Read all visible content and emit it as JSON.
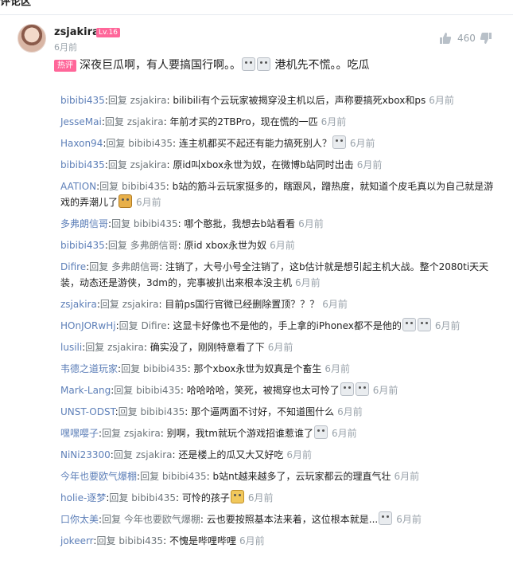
{
  "header_cut_text": "评论区",
  "main_comment": {
    "username": "zsjakira",
    "level": "Lv.16",
    "time": "6月前",
    "likes": "460",
    "badge": "热评",
    "text_before": "深夜巨瓜啊，有人要搞国行啊。。",
    "text_after": "港机先不慌。。吃瓜"
  },
  "replies": [
    {
      "user": "bibibi435",
      "reply_to": "zsjakira",
      "text": "bilibili有个云玩家被揭穿没主机以后，声称要搞死xbox和ps",
      "time": "6月前",
      "emotes": []
    },
    {
      "user": "JesseMai",
      "reply_to": "zsjakira",
      "text": "年前才买的2TBPro，现在慌的一匹",
      "time": "6月前",
      "emotes": []
    },
    {
      "user": "Haxon94",
      "reply_to": "bibibi435",
      "text": "连主机都买不起还有能力搞死别人？",
      "time": "6月前",
      "emotes": [
        "face"
      ]
    },
    {
      "user": "bibibi435",
      "reply_to": "zsjakira",
      "text": "原id叫xbox永世为奴，在微博b站同时出击",
      "time": "6月前",
      "emotes": []
    },
    {
      "user": "AATION",
      "reply_to": "bibibi435",
      "text": "b站的筋斗云玩家挺多的，瞎跟风，蹭热度，就知道个皮毛真以为自己就是游戏的弄潮儿了",
      "time": "6月前",
      "emotes": [
        "dog"
      ]
    },
    {
      "user": "多弗朗信哥",
      "reply_to": "bibibi435",
      "text": "哪个憨批，我想去b站看看",
      "time": "6月前",
      "emotes": []
    },
    {
      "user": "bibibi435",
      "reply_to": "多弗朗信哥",
      "text": "原id xbox永世为奴",
      "time": "6月前",
      "emotes": []
    },
    {
      "user": "Difire",
      "reply_to": "多弗朗信哥",
      "text": "注销了，大号小号全注销了，这b估计就是想引起主机大战。整个2080ti天天装，动态还是游侠，3dm的，完事被扒出来根本没主机",
      "time": "6月前",
      "emotes": []
    },
    {
      "user": "zsjakira",
      "reply_to": "zsjakira",
      "text": "目前ps国行官微已经删除置顶？？？",
      "time": "6月前",
      "emotes": []
    },
    {
      "user": "HOnJORwHj",
      "reply_to": "Difire",
      "text": "这显卡好像也不是他的，手上拿的iPhonex都不是他的",
      "time": "6月前",
      "emotes": [
        "face",
        "face"
      ]
    },
    {
      "user": "lusili",
      "reply_to": "zsjakira",
      "text": "确实没了，刚刚特意看了下",
      "time": "6月前",
      "emotes": []
    },
    {
      "user": "韦德之道玩家",
      "reply_to": "bibibi435",
      "text": "那个xbox永世为奴真是个畜生",
      "time": "6月前",
      "emotes": []
    },
    {
      "user": "Mark-Lang",
      "reply_to": "bibibi435",
      "text": "哈哈哈哈，笑死，被揭穿也太可怜了",
      "time": "6月前",
      "emotes": [
        "face",
        "face"
      ]
    },
    {
      "user": "UNST-ODST",
      "reply_to": "bibibi435",
      "text": "那个逼两面不讨好，不知道图什么",
      "time": "6月前",
      "emotes": []
    },
    {
      "user": "嘿嘿嘤子",
      "reply_to": "zsjakira",
      "text": "别啊，我tm就玩个游戏招谁惹谁了",
      "time": "6月前",
      "emotes": [
        "face"
      ]
    },
    {
      "user": "NiNi23300",
      "reply_to": "zsjakira",
      "text": "还是楼上的瓜又大又好吃",
      "time": "6月前",
      "emotes": []
    },
    {
      "user": "今年也要欧气爆棚",
      "reply_to": "bibibi435",
      "text": "b站nt越来越多了，云玩家都云的理直气壮",
      "time": "6月前",
      "emotes": []
    },
    {
      "user": "holie-逐梦",
      "reply_to": "bibibi435",
      "text": "可怜的孩子",
      "time": "6月前",
      "emotes": [
        "cat"
      ]
    },
    {
      "user": "口你太美",
      "reply_to": "今年也要欧气爆棚",
      "text": "云也要按照基本法来着，这位根本就是...",
      "time": "6月前",
      "emotes": [
        "face"
      ]
    },
    {
      "user": "jokeerr",
      "reply_to": "bibibi435",
      "text": "不愧是哔哩哔哩",
      "time": "6月前",
      "emotes": []
    }
  ],
  "reply_word": "回复",
  "colors": {
    "username": "#5d7fb8",
    "time": "#99a2aa",
    "badge": "#ff6699"
  }
}
